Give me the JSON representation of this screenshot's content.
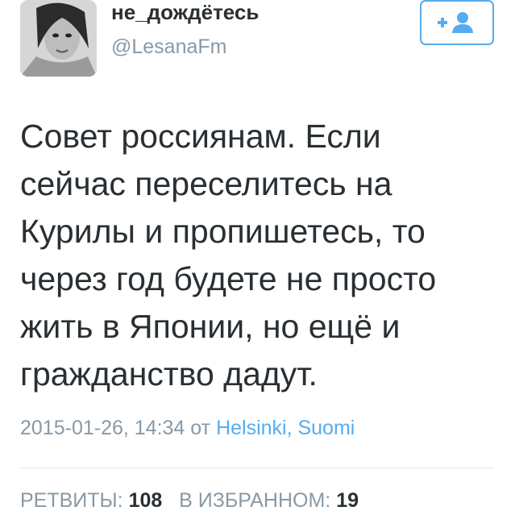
{
  "profile": {
    "name": "не_дождётесь",
    "handle": "@LesanaFm",
    "follow_icon": "add-user-icon"
  },
  "tweet": {
    "lines": [
      "Совет россиянам. Если",
      "сейчас переселитесь на",
      "Курилы и пропишетесь, то",
      "через год будете не просто",
      "жить в Японии, но ещё и",
      "гражданство дадут."
    ]
  },
  "meta": {
    "timestamp": "2015-01-26, 14:34",
    "from_label": "от",
    "location": "Helsinki, Suomi"
  },
  "stats": {
    "retweets_label": "РЕТВИТЫ:",
    "retweets_count": "108",
    "favorites_label": "В ИЗБРАННОМ:",
    "favorites_count": "19"
  },
  "colors": {
    "accent": "#55acee",
    "text": "#292f33",
    "muted": "#8899a6"
  }
}
